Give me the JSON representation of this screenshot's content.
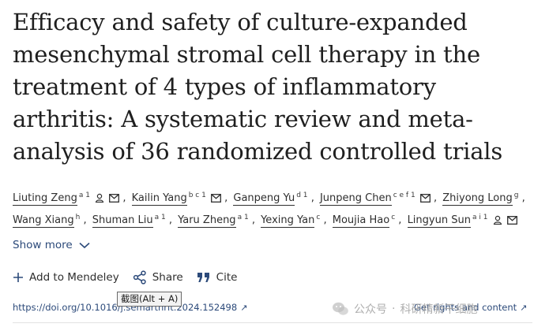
{
  "article": {
    "title": "Efficacy and safety of culture-expanded mesenchymal stromal cell therapy in the treatment of 4 types of inflammatory arthritis: A systematic review and meta-analysis of 36 randomized controlled trials"
  },
  "authors": [
    {
      "name": "Liuting Zeng",
      "sup": "a 1",
      "person_icon": true,
      "mail_icon": true
    },
    {
      "name": "Kailin Yang",
      "sup": "b c 1",
      "person_icon": false,
      "mail_icon": true
    },
    {
      "name": "Ganpeng Yu",
      "sup": "d 1",
      "person_icon": false,
      "mail_icon": false
    },
    {
      "name": "Junpeng Chen",
      "sup": "c e f 1",
      "person_icon": false,
      "mail_icon": true
    },
    {
      "name": "Zhiyong Long",
      "sup": "g",
      "person_icon": false,
      "mail_icon": false
    },
    {
      "name": "Wang Xiang",
      "sup": "h",
      "person_icon": false,
      "mail_icon": false
    },
    {
      "name": "Shuman Liu",
      "sup": "a 1",
      "person_icon": false,
      "mail_icon": false
    },
    {
      "name": "Yaru Zheng",
      "sup": "a 1",
      "person_icon": false,
      "mail_icon": false
    },
    {
      "name": "Yexing Yan",
      "sup": "c",
      "person_icon": false,
      "mail_icon": false
    },
    {
      "name": "Moujia Hao",
      "sup": "c",
      "person_icon": false,
      "mail_icon": false
    },
    {
      "name": "Lingyun Sun",
      "sup": "a i 1",
      "person_icon": true,
      "mail_icon": true
    }
  ],
  "show_more": {
    "label": "Show more"
  },
  "actions": {
    "mendeley": "Add to Mendeley",
    "share": "Share",
    "cite": "Cite"
  },
  "doi": {
    "label": "https://doi.org/10.1016/j.semarthrit.2024.152498"
  },
  "rights": {
    "label": "Get rights and content"
  },
  "tooltip": {
    "label": "截图(Alt + A)"
  },
  "watermark": {
    "text": "公众号",
    "name": "科研精新干细胞"
  },
  "colors": {
    "link": "#2c4a7a",
    "text": "#1f1f1f"
  }
}
